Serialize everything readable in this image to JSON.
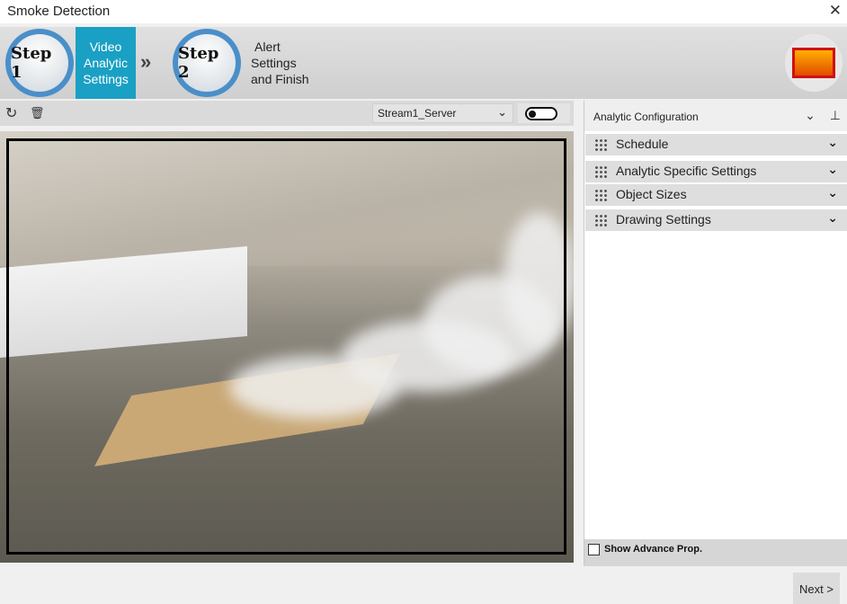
{
  "window": {
    "title": "Smoke Detection",
    "close": "✕"
  },
  "wizard": {
    "step1": {
      "badge": "Step 1",
      "label_lines": [
        "Video",
        "Analytic",
        "Settings"
      ]
    },
    "separator": "»",
    "step2": {
      "badge": "Step 2",
      "label_lines": [
        "Alert",
        "Settings",
        "and Finish"
      ]
    }
  },
  "toolbar": {
    "refresh_icon": "↻",
    "delete_icon": "🗑",
    "stream_value": "Stream1_Server",
    "stream_chevron": "⌄"
  },
  "panel": {
    "title": "Analytic Configuration",
    "sections": [
      {
        "label": "Schedule",
        "chevron": "⌄"
      },
      {
        "label": "Analytic Specific Settings",
        "chevron": "⌄"
      },
      {
        "label": "Object Sizes",
        "chevron": "⌄"
      },
      {
        "label": "Drawing Settings",
        "chevron": "⌄"
      }
    ],
    "show_advance_label": "Show Advance Prop."
  },
  "footer": {
    "next_label": "Next >"
  }
}
